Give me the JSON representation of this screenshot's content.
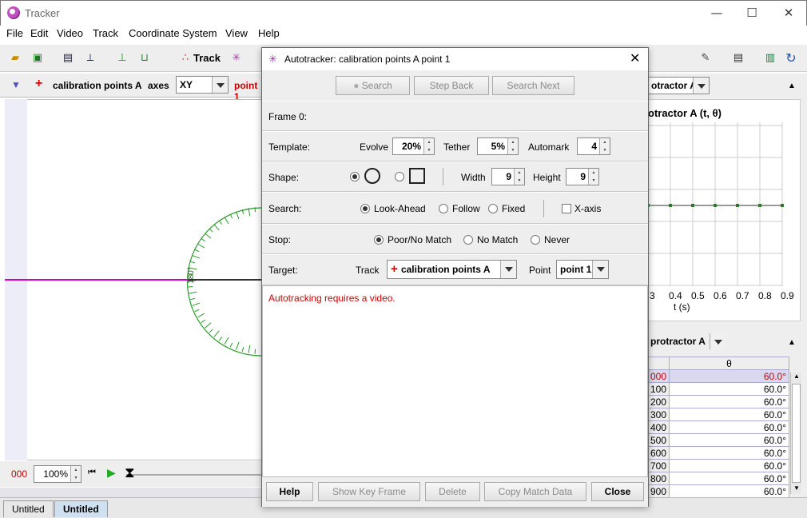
{
  "window": {
    "title": "Tracker",
    "min": "—",
    "max": "☐",
    "close": "✕"
  },
  "menu": [
    "File",
    "Edit",
    "Video",
    "Track",
    "Coordinate System",
    "View",
    "Help"
  ],
  "toolbar": {
    "track_label": "Track"
  },
  "trackbar": {
    "track_name": "calibration points A",
    "axes_label": "axes",
    "axes_value": "XY",
    "point_label": "point 1"
  },
  "canvas": {
    "angle_label": "180°"
  },
  "player": {
    "frame": "000",
    "zoom": "100%"
  },
  "tabs": [
    "Untitled",
    "Untitled"
  ],
  "right": {
    "plot_track": "otractor A",
    "plot_title": "otractor A (t, θ)",
    "x_ticks": [
      "3",
      "0.4",
      "0.5",
      "0.6",
      "0.7",
      "0.8",
      "0.9"
    ],
    "x_label": "t (s)",
    "table_track": "protractor A",
    "table_col": "θ",
    "table_rows": [
      {
        "t": "000",
        "v": "60.0°"
      },
      {
        "t": "100",
        "v": "60.0°"
      },
      {
        "t": "200",
        "v": "60.0°"
      },
      {
        "t": "300",
        "v": "60.0°"
      },
      {
        "t": "400",
        "v": "60.0°"
      },
      {
        "t": "500",
        "v": "60.0°"
      },
      {
        "t": "600",
        "v": "60.0°"
      },
      {
        "t": "700",
        "v": "60.0°"
      },
      {
        "t": "800",
        "v": "60.0°"
      },
      {
        "t": "900",
        "v": "60.0°"
      }
    ]
  },
  "dialog": {
    "title": "Autotracker: calibration points A point 1",
    "search": "Search",
    "step_back": "Step Back",
    "search_next": "Search Next",
    "frame_label": "Frame 0:",
    "template_label": "Template:",
    "evolve_label": "Evolve",
    "evolve": "20%",
    "tether_label": "Tether",
    "tether": "5%",
    "automark_label": "Automark",
    "automark": "4",
    "shape_label": "Shape:",
    "width_label": "Width",
    "width": "9",
    "height_label": "Height",
    "height": "9",
    "search_label": "Search:",
    "look_ahead": "Look-Ahead",
    "follow": "Follow",
    "fixed": "Fixed",
    "x_axis": "X-axis",
    "stop_label": "Stop:",
    "poor_match": "Poor/No Match",
    "no_match": "No Match",
    "never": "Never",
    "target_label": "Target:",
    "track_label": "Track",
    "track_value": "calibration points A",
    "point_label": "Point",
    "point_value": "point 1",
    "message": "Autotracking requires a video.",
    "help": "Help",
    "show_key_frame": "Show Key Frame",
    "delete": "Delete",
    "copy_match": "Copy Match Data",
    "close": "Close"
  },
  "colors": {
    "accent_red": "#cc0000",
    "magenta_axis": "#cc00cc",
    "protractor_green": "#2a9a2a"
  }
}
